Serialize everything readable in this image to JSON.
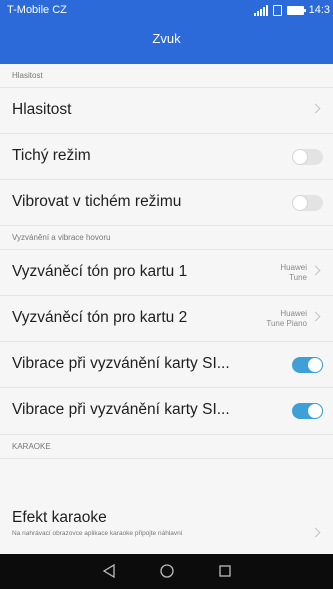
{
  "status_bar": {
    "carrier": "T-Mobile CZ",
    "time": "14:3",
    "icons": [
      "signal-icon",
      "sim-icon",
      "battery-icon"
    ]
  },
  "header": {
    "title": "Zvuk"
  },
  "sections": {
    "volume": {
      "label": "Hlasitost"
    },
    "ringing": {
      "label": "Vyzvánění a vibrace hovoru"
    },
    "karaoke": {
      "label": "KARAOKE"
    }
  },
  "rows": {
    "volume": {
      "label": "Hlasitost"
    },
    "silent_mode": {
      "label": "Tichý režim",
      "toggle_on": false
    },
    "vibrate_silent": {
      "label": "Vibrovat v tichém režimu",
      "toggle_on": false
    },
    "ringtone_card1": {
      "label": "Vyzváněcí tón pro kartu 1",
      "value_line1": "Huawei",
      "value_line2": "Tune"
    },
    "ringtone_card2": {
      "label": "Vyzváněcí tón pro kartu 2",
      "value_line1": "Huawei",
      "value_line2": "Tune Piano"
    },
    "vibrate_sim1": {
      "label": "Vibrace při vyzvánění karty SI...",
      "toggle_on": true
    },
    "vibrate_sim2": {
      "label": "Vibrace při vyzvánění karty SI...",
      "toggle_on": true
    },
    "karaoke_effect": {
      "label": "Efekt karaoke",
      "description": "Na nahrávací obrazovce aplikace karaoke připojte náhlavní"
    }
  },
  "navbar": {
    "buttons": [
      "back-icon",
      "home-icon",
      "recent-apps-icon"
    ]
  },
  "colors": {
    "header_bg": "#2d6ad9",
    "toggle_on": "#3ea0d6",
    "toggle_off": "#e3e3e3",
    "background": "#f6f6f6",
    "navbar_bg": "#0c0c0c"
  }
}
